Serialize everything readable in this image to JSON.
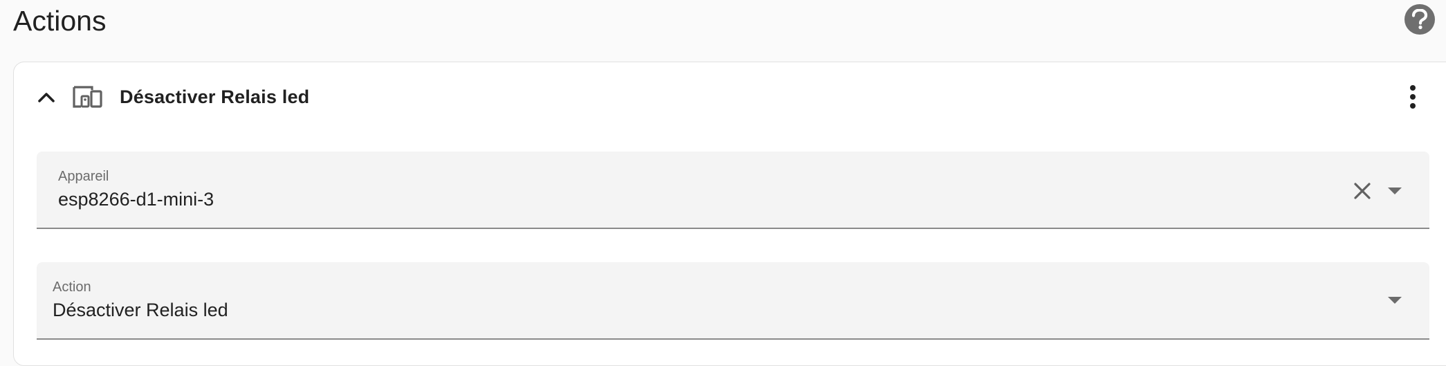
{
  "section": {
    "title": "Actions",
    "help_icon": "help-circle-icon"
  },
  "action_card": {
    "title": "Désactiver Relais led",
    "collapse_icon": "chevron-up-icon",
    "type_icon": "devices-icon",
    "menu_icon": "dots-vertical-icon",
    "device_field": {
      "label": "Appareil",
      "value": "esp8266-d1-mini-3",
      "clear_icon": "close-icon",
      "dropdown_icon": "menu-down-icon"
    },
    "action_field": {
      "label": "Action",
      "value": "Désactiver Relais led",
      "dropdown_icon": "menu-down-icon"
    }
  }
}
